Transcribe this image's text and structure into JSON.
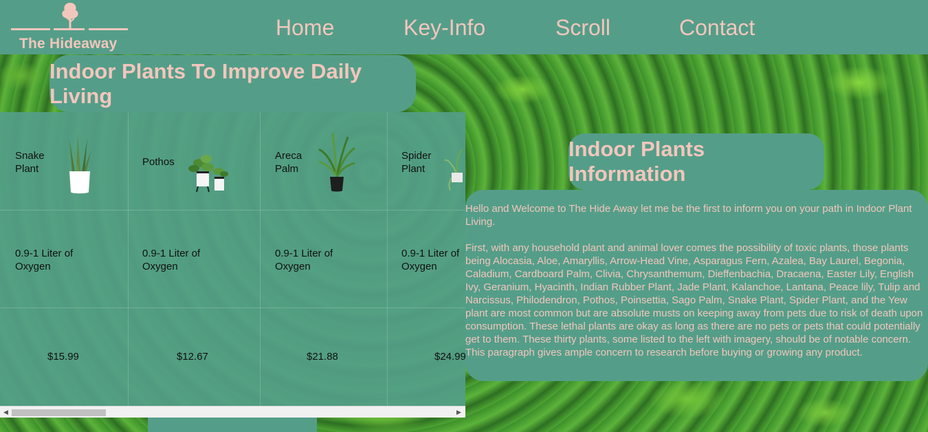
{
  "header": {
    "logo_text": "The Hideaway",
    "nav": [
      {
        "label": "Home"
      },
      {
        "label": "Key-Info"
      },
      {
        "label": "Scroll"
      },
      {
        "label": "Contact"
      }
    ]
  },
  "main": {
    "title": "Indoor Plants To Improve Daily Living",
    "plants": [
      {
        "name": "Snake Plant",
        "oxygen": "0.9-1 Liter of Oxygen",
        "price": "$15.99",
        "icon": "snake-plant-icon"
      },
      {
        "name": "Pothos",
        "oxygen": "0.9-1 Liter of Oxygen",
        "price": "$12.67",
        "icon": "pothos-icon"
      },
      {
        "name": "Areca Palm",
        "oxygen": "0.9-1 Liter of Oxygen",
        "price": "$21.88",
        "icon": "areca-palm-icon"
      },
      {
        "name": "Spider Plant",
        "oxygen": "0.9-1 Liter of Oxygen",
        "price": "$24.99",
        "icon": "spider-plant-icon"
      }
    ]
  },
  "info": {
    "title": "Indoor Plants Information",
    "paragraphs": [
      "Hello and Welcome to The Hide Away let me be the first to inform you on your path in Indoor Plant Living.",
      "First, with any household plant and animal lover comes the possibility of toxic plants, those plants being Alocasia, Aloe, Amaryllis, Arrow-Head Vine, Asparagus Fern, Azalea, Bay Laurel, Begonia, Caladium, Cardboard Palm, Clivia, Chrysanthemum, Dieffenbachia, Dracaena, Easter Lily, English Ivy, Geranium, Hyacinth, Indian Rubber Plant, Jade Plant, Kalanchoe, Lantana, Peace lily, Tulip and Narcissus, Philodendron, Pothos, Poinsettia, Sago Palm, Snake Plant, Spider Plant, and the Yew plant are most common but are absolute musts on keeping away from pets due to risk of death upon consumption. These lethal plants are okay as long as there are no pets or pets that could potentially get to them. These thirty plants, some listed to the left with imagery, should be of notable concern. This paragraph gives ample concern to research before buying or growing any product."
    ]
  },
  "colors": {
    "header_bg": "#549e89",
    "accent_text": "#f3c6bc"
  }
}
